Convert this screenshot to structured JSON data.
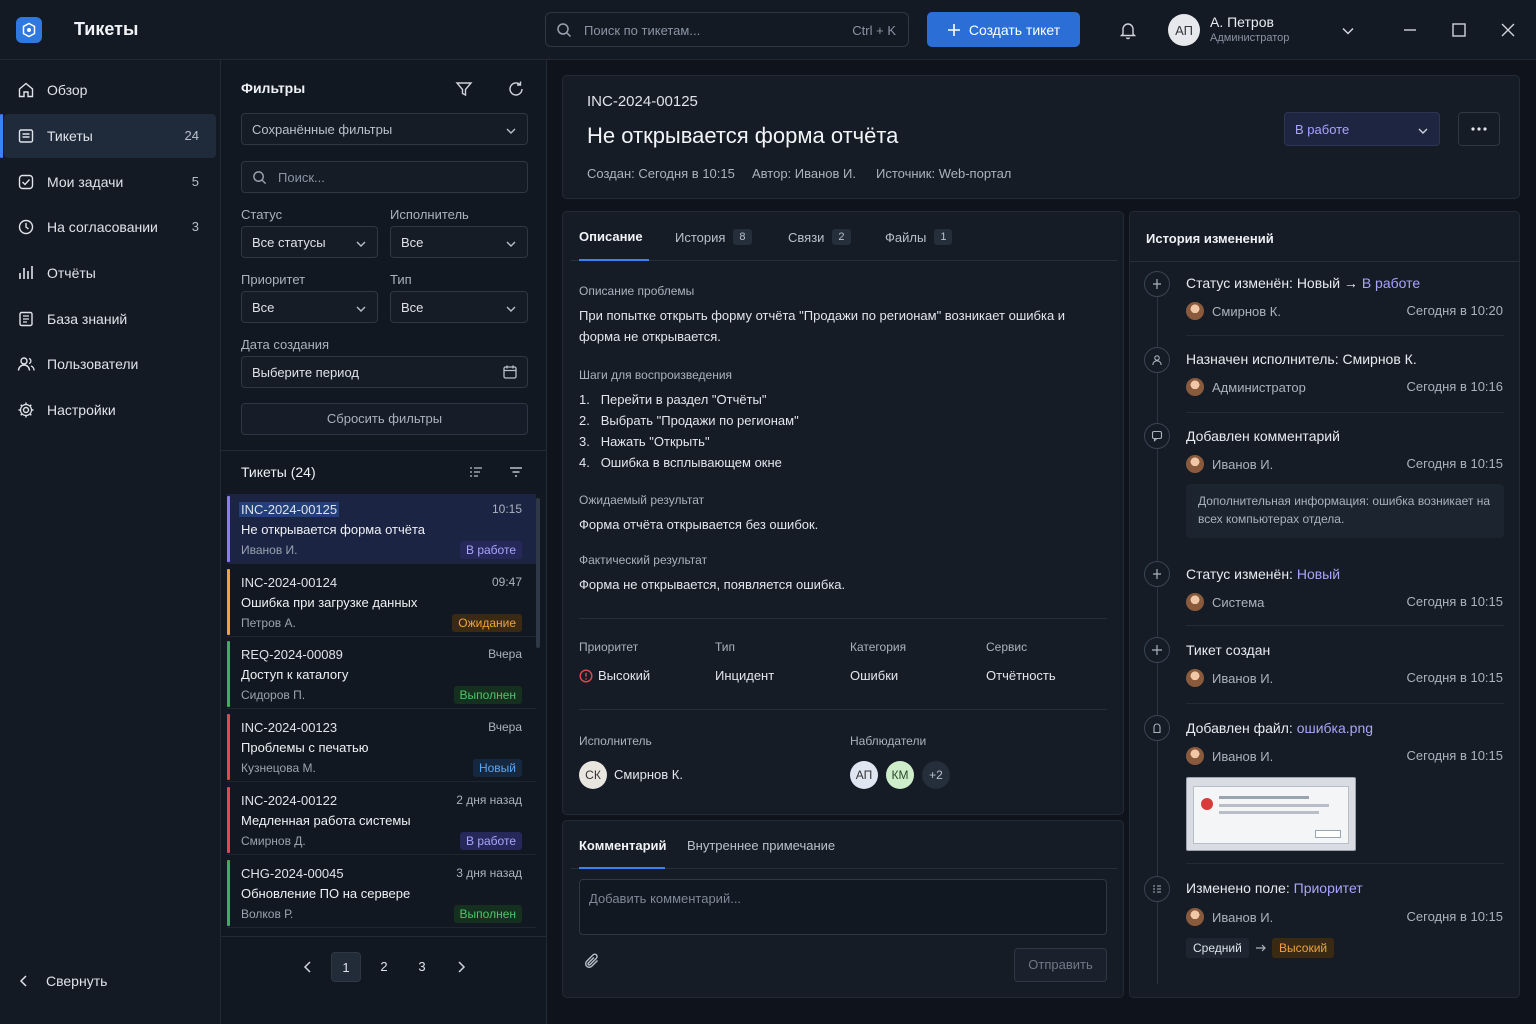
{
  "app": {
    "title": "Тикеты"
  },
  "search": {
    "placeholder": "Поиск по тикетам...",
    "shortcut": "Ctrl + K"
  },
  "create_button": "Создать тикет",
  "user": {
    "initials": "АП",
    "name": "А. Петров",
    "role": "Администратор"
  },
  "sidebar": {
    "items": [
      {
        "label": "Обзор",
        "count": "",
        "icon": "home-icon"
      },
      {
        "label": "Тикеты",
        "count": "24",
        "icon": "ticket-icon"
      },
      {
        "label": "Мои задачи",
        "count": "5",
        "icon": "check-icon"
      },
      {
        "label": "На согласовании",
        "count": "3",
        "icon": "clock-icon"
      },
      {
        "label": "Отчёты",
        "count": "",
        "icon": "chart-icon"
      },
      {
        "label": "База знаний",
        "count": "",
        "icon": "book-icon"
      },
      {
        "label": "Пользователи",
        "count": "",
        "icon": "users-icon"
      },
      {
        "label": "Настройки",
        "count": "",
        "icon": "gear-icon"
      }
    ],
    "collapse": "Свернуть"
  },
  "filters": {
    "title": "Фильтры",
    "saved": "Сохранённые фильтры",
    "search_placeholder": "Поиск...",
    "status_label": "Статус",
    "status_value": "Все статусы",
    "assignee_label": "Исполнитель",
    "assignee_value": "Все",
    "priority_label": "Приоритет",
    "priority_value": "Все",
    "type_label": "Тип",
    "type_value": "Все",
    "date_label": "Дата создания",
    "date_value": "Выберите период",
    "reset": "Сбросить фильтры"
  },
  "tickets": {
    "header": "Тикеты (24)",
    "items": [
      {
        "id": "INC-2024-00125",
        "time": "10:15",
        "title": "Не открывается форма отчёта",
        "author": "Иванов И.",
        "status": "В работе",
        "status_color": "#a9a4ff",
        "status_bg": "#26285a",
        "bar": "#8b7cf6"
      },
      {
        "id": "INC-2024-00124",
        "time": "09:47",
        "title": "Ошибка при загрузке данных",
        "author": "Петров А.",
        "status": "Ожидание",
        "status_color": "#f0a33a",
        "status_bg": "#3a2a14",
        "bar": "#f0a33a"
      },
      {
        "id": "REQ-2024-00089",
        "time": "Вчера",
        "title": "Доступ к каталогу",
        "author": "Сидоров П.",
        "status": "Выполнен",
        "status_color": "#4cc46a",
        "status_bg": "#16301f",
        "bar": "#3fae5c"
      },
      {
        "id": "INC-2024-00123",
        "time": "Вчера",
        "title": "Проблемы с печатью",
        "author": "Кузнецова М.",
        "status": "Новый",
        "status_color": "#5aa9f5",
        "status_bg": "#15283f",
        "bar": "#e04a4a"
      },
      {
        "id": "INC-2024-00122",
        "time": "2 дня назад",
        "title": "Медленная работа системы",
        "author": "Смирнов Д.",
        "status": "В работе",
        "status_color": "#a9a4ff",
        "status_bg": "#26285a",
        "bar": "#e04a4a"
      },
      {
        "id": "CHG-2024-00045",
        "time": "3 дня назад",
        "title": "Обновление ПО на сервере",
        "author": "Волков Р.",
        "status": "Выполнен",
        "status_color": "#4cc46a",
        "status_bg": "#16301f",
        "bar": "#3fae5c"
      }
    ],
    "pages": [
      "1",
      "2",
      "3"
    ]
  },
  "detail": {
    "id": "INC-2024-00125",
    "title": "Не открывается форма отчёта",
    "created": "Создан: Сегодня в 10:15",
    "author": "Автор: Иванов И.",
    "source": "Источник: Web-портал",
    "status": "В работе",
    "tabs": [
      {
        "label": "Описание",
        "count": ""
      },
      {
        "label": "История",
        "count": "8"
      },
      {
        "label": "Связи",
        "count": "2"
      },
      {
        "label": "Файлы",
        "count": "1"
      }
    ],
    "problem_title": "Описание проблемы",
    "problem_text": "При попытке открыть форму отчёта \"Продажи по регионам\" возникает ошибка и форма не открывается.",
    "steps_title": "Шаги для воспроизведения",
    "steps": [
      "Перейти в раздел \"Отчёты\"",
      "Выбрать \"Продажи по регионам\"",
      "Нажать \"Открыть\"",
      "Ошибка в всплывающем окне"
    ],
    "expected_title": "Ожидаемый результат",
    "expected_text": "Форма отчёта открывается без ошибок.",
    "actual_title": "Фактический результат",
    "actual_text": "Форма не открывается, появляется ошибка.",
    "props": {
      "priority_label": "Приоритет",
      "priority": "Высокий",
      "type_label": "Тип",
      "type": "Инцидент",
      "category_label": "Категория",
      "category": "Ошибки",
      "service_label": "Сервис",
      "service": "Отчётность"
    },
    "assignee_label": "Исполнитель",
    "assignee_initials": "СК",
    "assignee_name": "Смирнов К.",
    "watchers_label": "Наблюдатели",
    "watchers": [
      "АП",
      "КМ"
    ],
    "watchers_more": "+2"
  },
  "comment": {
    "tab_comment": "Комментарий",
    "tab_internal": "Внутреннее примечание",
    "placeholder": "Добавить комментарий...",
    "send": "Отправить"
  },
  "history": {
    "title": "История изменений",
    "items": [
      {
        "prefix": "Статус изменён: Новый → ",
        "link": "В работе",
        "person": "Смирнов К.",
        "date": "Сегодня в 10:20",
        "icon": "status-icon"
      },
      {
        "prefix": "Назначен исполнитель: Смирнов К.",
        "link": "",
        "person": "Администратор",
        "date": "Сегодня в 10:16",
        "icon": "user-icon"
      },
      {
        "prefix": "Добавлен комментарий",
        "link": "",
        "person": "Иванов И.",
        "date": "Сегодня в 10:15",
        "icon": "comment-icon",
        "note": "Дополнительная информация: ошибка возникает на всех компьютерах отдела."
      },
      {
        "prefix": "Статус изменён: ",
        "link": "Новый",
        "person": "Система",
        "date": "Сегодня в 10:15",
        "icon": "status-icon"
      },
      {
        "prefix": "Тикет создан",
        "link": "",
        "person": "Иванов И.",
        "date": "Сегодня в 10:15",
        "icon": "plus-icon"
      },
      {
        "prefix": "Добавлен файл: ",
        "link": "ошибка.png",
        "person": "Иванов И.",
        "date": "Сегодня в 10:15",
        "icon": "file-icon"
      },
      {
        "prefix": "Изменено поле: ",
        "link": "Приоритет",
        "person": "Иванов И.",
        "date": "Сегодня в 10:15",
        "icon": "field-icon",
        "from": "Средний",
        "to": "Высокий"
      }
    ]
  }
}
